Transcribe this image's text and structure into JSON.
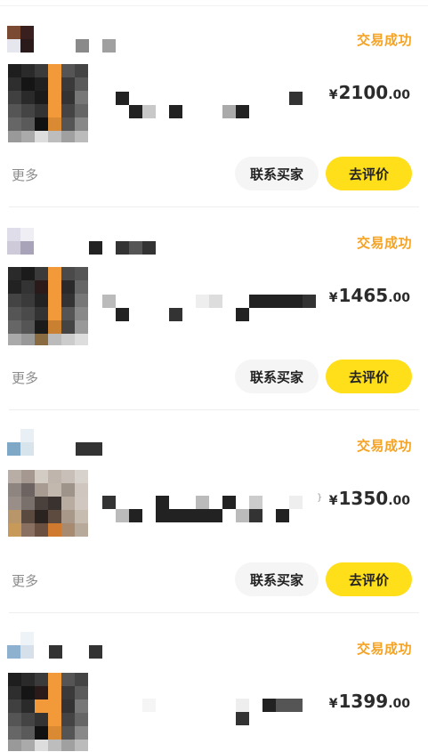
{
  "colors": {
    "status": "#f5a323",
    "review_button": "#ffde1a",
    "contact_button": "#f5f5f5"
  },
  "orders": [
    {
      "status": "交易成功",
      "price_symbol": "¥",
      "price_int": "2100",
      "price_dec": ".00",
      "more_label": "更多",
      "contact_label": "联系买家",
      "review_label": "去评价",
      "mark": ""
    },
    {
      "status": "交易成功",
      "price_symbol": "¥",
      "price_int": "1465",
      "price_dec": ".00",
      "more_label": "更多",
      "contact_label": "联系买家",
      "review_label": "去评价",
      "mark": ""
    },
    {
      "status": "交易成功",
      "price_symbol": "¥",
      "price_int": "1350",
      "price_dec": ".00",
      "more_label": "更多",
      "contact_label": "联系买家",
      "review_label": "去评价",
      "mark": "}"
    },
    {
      "status": "交易成功",
      "price_symbol": "¥",
      "price_int": "1399",
      "price_dec": ".00",
      "more_label": "",
      "contact_label": "",
      "review_label": "",
      "mark": ""
    }
  ]
}
